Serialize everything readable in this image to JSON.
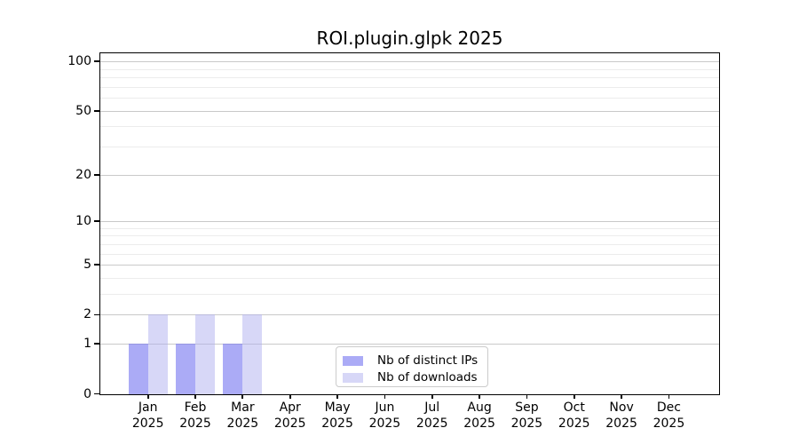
{
  "chart_data": {
    "type": "bar",
    "title": "ROI.plugin.glpk 2025",
    "x_ticks": [
      {
        "label": "Jan",
        "year": "2025"
      },
      {
        "label": "Feb",
        "year": "2025"
      },
      {
        "label": "Mar",
        "year": "2025"
      },
      {
        "label": "Apr",
        "year": "2025"
      },
      {
        "label": "May",
        "year": "2025"
      },
      {
        "label": "Jun",
        "year": "2025"
      },
      {
        "label": "Jul",
        "year": "2025"
      },
      {
        "label": "Aug",
        "year": "2025"
      },
      {
        "label": "Sep",
        "year": "2025"
      },
      {
        "label": "Oct",
        "year": "2025"
      },
      {
        "label": "Nov",
        "year": "2025"
      },
      {
        "label": "Dec",
        "year": "2025"
      }
    ],
    "series": [
      {
        "name": "Nb of distinct IPs",
        "color": "#ababf6",
        "fill": "rgba(120,120,240,0.62)",
        "values": [
          1,
          1,
          1,
          0,
          0,
          0,
          0,
          0,
          0,
          0,
          0,
          0
        ]
      },
      {
        "name": "Nb of downloads",
        "color": "#d7d7f7",
        "fill": "rgba(175,175,240,0.5)",
        "values": [
          2,
          2,
          2,
          0,
          0,
          0,
          0,
          0,
          0,
          0,
          0,
          0
        ]
      }
    ],
    "y_axis": {
      "scale": "log1p",
      "major_ticks": [
        0,
        1,
        2,
        5,
        10,
        20,
        50,
        100
      ],
      "minor_ticks": [
        3,
        4,
        6,
        7,
        8,
        9,
        30,
        40,
        60,
        70,
        80,
        90
      ],
      "max": 113
    },
    "grid": {
      "major_color": "#c9c9c9",
      "minor_color": "#ececec"
    },
    "legend_position": "bottom-center",
    "axis_color": "#000000"
  }
}
